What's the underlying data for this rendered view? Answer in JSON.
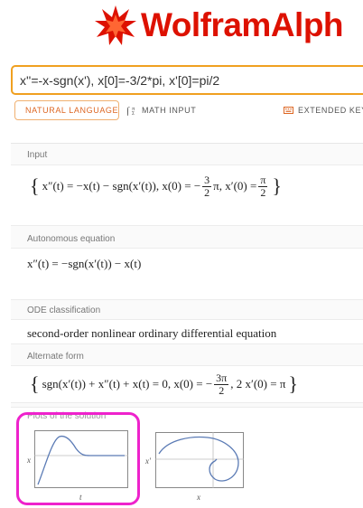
{
  "header": {
    "logo_text": "WolframAlph",
    "logo_icon": "wolfram-star-icon"
  },
  "query": {
    "value": "x''=-x-sgn(x'), x[0]=-3/2*pi, x'[0]=pi/2"
  },
  "modes": {
    "natural_language": "NATURAL LANGUAGE",
    "math_input": "MATH INPUT",
    "extended_keyboard": "EXTENDED KEYB"
  },
  "pods": {
    "input": {
      "title": "Input",
      "lhs": "x″(t) = −x(t) − sgn(x′(t)), x(0) = −",
      "frac1_num": "3",
      "frac1_den": "2",
      "mid": "π, x′(0) =",
      "frac2_num": "π",
      "frac2_den": "2"
    },
    "autonomous": {
      "title": "Autonomous equation",
      "expr": "x″(t) = −sgn(x′(t)) − x(t)"
    },
    "ode_classification": {
      "title": "ODE classification",
      "text": "second-order nonlinear ordinary differential equation"
    },
    "alternate_form": {
      "title": "Alternate form",
      "lhs": "sgn(x′(t)) + x″(t) + x(t) = 0, x(0) = −",
      "frac_num": "3π",
      "frac_den": "2",
      "rhs": ", 2 x′(0) = π"
    },
    "plots": {
      "title": "Plots of the solution",
      "plot1": {
        "ylabel": "x",
        "xlabel": "t"
      },
      "plot2": {
        "ylabel": "x′",
        "xlabel": "x"
      }
    }
  },
  "colors": {
    "brand_red": "#dd1100",
    "query_border": "#f0a020",
    "highlight": "#ee22cc"
  }
}
